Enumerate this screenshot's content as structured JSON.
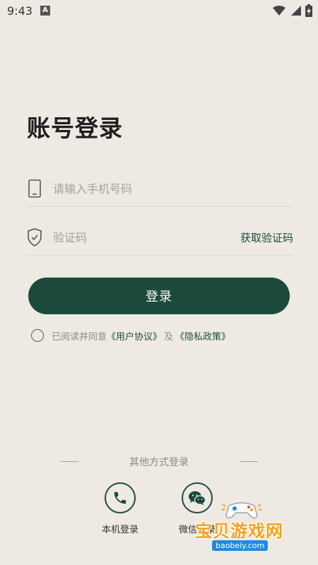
{
  "status_bar": {
    "time": "9:43",
    "notification_letter": "A"
  },
  "page_title": "账号登录",
  "phone_field": {
    "placeholder": "请输入手机号码",
    "value": ""
  },
  "code_field": {
    "placeholder": "验证码",
    "value": "",
    "get_code_label": "获取验证码"
  },
  "login_button_label": "登录",
  "agreement": {
    "prefix": "已阅读并同意",
    "user_agreement": "《用户协议》",
    "separator": "及",
    "privacy_policy": "《隐私政策》",
    "checked": false
  },
  "other_login": {
    "title": "其他方式登录",
    "options": [
      {
        "label": "本机登录",
        "icon": "phone-icon"
      },
      {
        "label": "微信登录",
        "icon": "wechat-icon"
      }
    ]
  },
  "watermark": {
    "text": "宝贝游戏网",
    "url": "baobeiy.com"
  },
  "colors": {
    "background": "#eeeae3",
    "primary": "#1c4a3c",
    "muted_text": "#8d8a84",
    "watermark_orange": "#f6a11a",
    "watermark_blue": "#1f8be0"
  }
}
